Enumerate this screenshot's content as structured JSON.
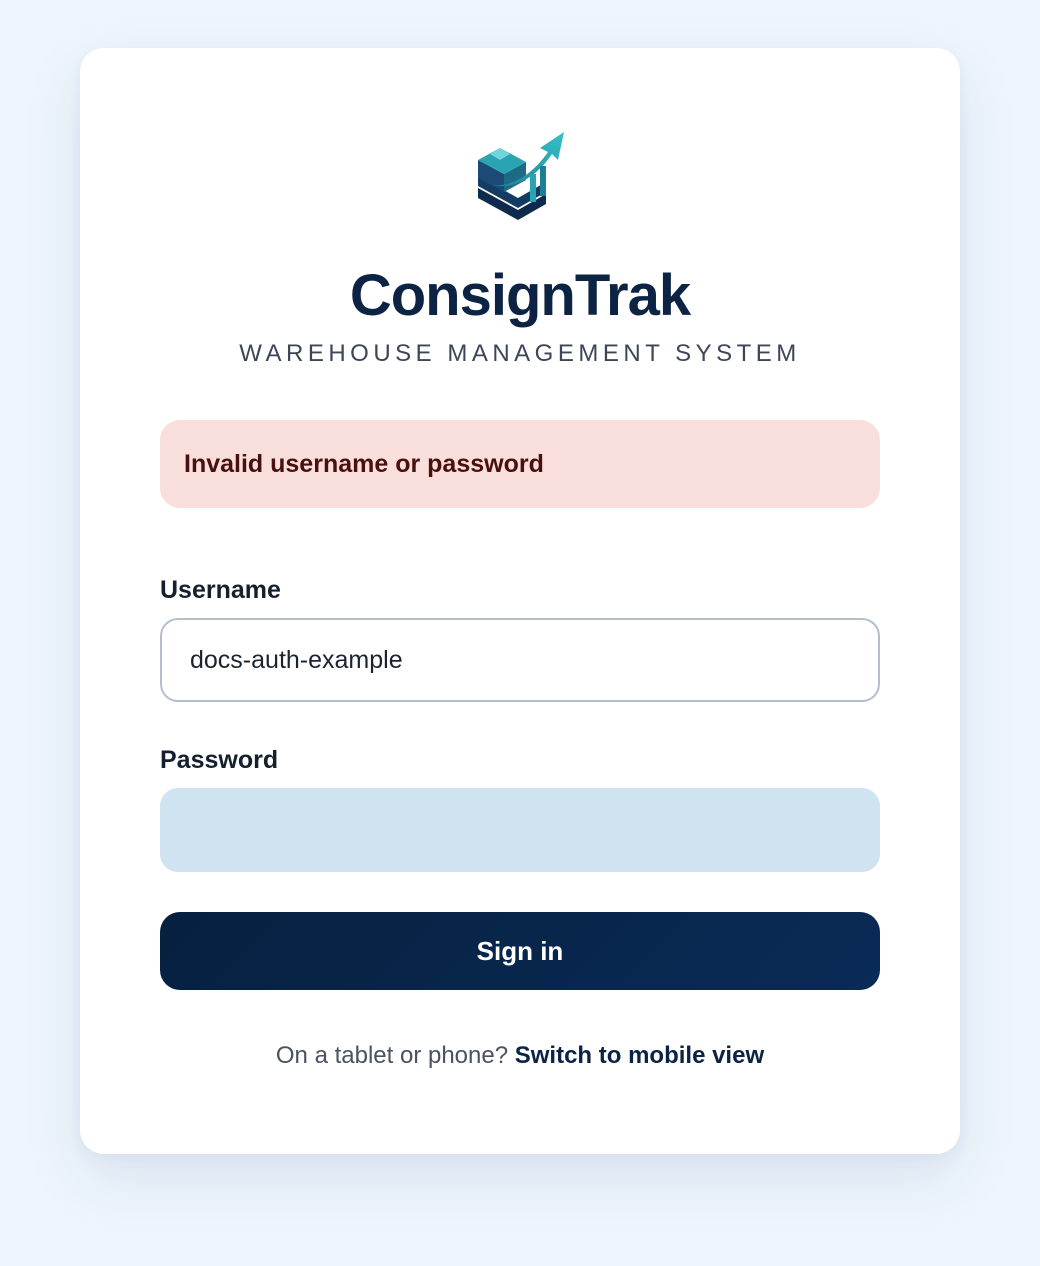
{
  "brand": {
    "name": "ConsignTrak",
    "tagline": "WAREHOUSE MANAGEMENT SYSTEM",
    "logo_icon": "warehouse-box-arrow-icon"
  },
  "alert": {
    "message": "Invalid username or password"
  },
  "form": {
    "username_label": "Username",
    "username_value": "docs-auth-example",
    "password_label": "Password",
    "password_value": "",
    "submit_label": "Sign in"
  },
  "footer": {
    "prompt": "On a tablet or phone?",
    "link_label": "Switch to mobile view"
  },
  "colors": {
    "brand_navy": "#0c2344",
    "accent_teal": "#2ba8b8",
    "error_bg": "#f8dfdc",
    "error_text": "#4a0f0f",
    "password_bg": "#cfe3f1"
  }
}
